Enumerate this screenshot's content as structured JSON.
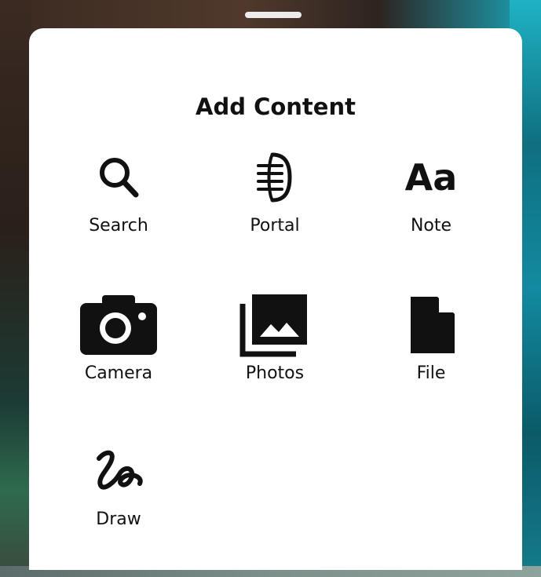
{
  "sheet": {
    "title": "Add Content"
  },
  "options": [
    {
      "id": "search",
      "label": "Search",
      "icon": "search-icon"
    },
    {
      "id": "portal",
      "label": "Portal",
      "icon": "portal-icon"
    },
    {
      "id": "note",
      "label": "Note",
      "icon": "note-icon",
      "glyph": "Aa"
    },
    {
      "id": "camera",
      "label": "Camera",
      "icon": "camera-icon"
    },
    {
      "id": "photos",
      "label": "Photos",
      "icon": "photos-icon"
    },
    {
      "id": "file",
      "label": "File",
      "icon": "file-icon"
    },
    {
      "id": "draw",
      "label": "Draw",
      "icon": "draw-icon"
    }
  ],
  "colors": {
    "sheet_background": "#ffffff",
    "text": "#111111",
    "handle": "#ececec"
  }
}
